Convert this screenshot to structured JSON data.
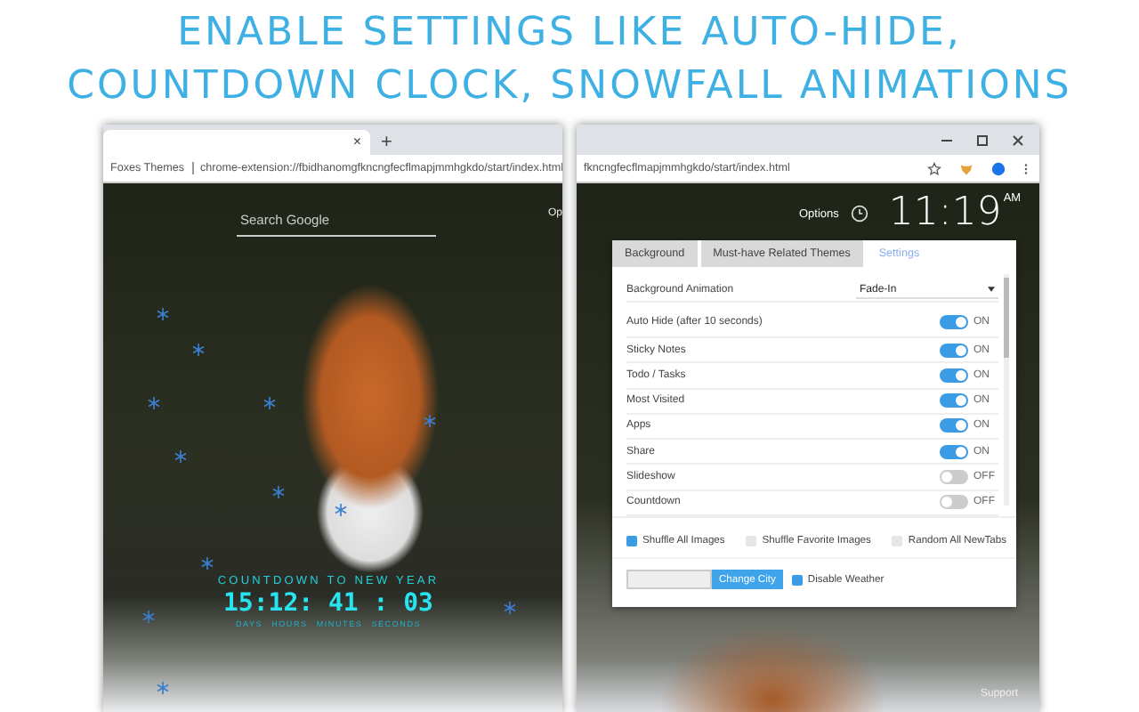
{
  "headline": [
    "ENABLE SETTINGS LIKE AUTO-HIDE,",
    "COUNTDOWN CLOCK, SNOWFALL ANIMATIONS"
  ],
  "left_window": {
    "tab_close": "×",
    "new_tab": "+",
    "site_name": "Foxes Themes",
    "url": "chrome-extension://fbidhanomgfkncngfecflmapjmmhgkdo/start/index.html",
    "search": {
      "placeholder": "Search Google"
    },
    "options_link": "Op",
    "countdown": {
      "title": "COUNTDOWN TO NEW YEAR",
      "time": "15:12: 41 : 03",
      "units": [
        "DAYS",
        "HOURS",
        "MINUTES",
        "SECONDS"
      ]
    }
  },
  "right_window": {
    "url": "fkncngfecflmapjmmhgkdo/start/index.html",
    "options_link": "Options",
    "clock": {
      "time": "11:19",
      "period": "AM"
    },
    "settings": {
      "tabs": [
        {
          "label": "Background",
          "selected": false
        },
        {
          "label": "Must-have Related Themes",
          "selected": false
        },
        {
          "label": "Settings",
          "selected": true
        }
      ],
      "animation": {
        "label": "Background Animation",
        "value": "Fade-In"
      },
      "toggles": [
        {
          "label": "Auto Hide (after 10 seconds)",
          "on": true,
          "state": "ON"
        },
        {
          "label": "Sticky Notes",
          "on": true,
          "state": "ON"
        },
        {
          "label": "Todo / Tasks",
          "on": true,
          "state": "ON"
        },
        {
          "label": "Most Visited",
          "on": true,
          "state": "ON"
        },
        {
          "label": "Apps",
          "on": true,
          "state": "ON"
        },
        {
          "label": "Share",
          "on": true,
          "state": "ON"
        },
        {
          "label": "Slideshow",
          "on": false,
          "state": "OFF"
        },
        {
          "label": "Countdown",
          "on": false,
          "state": "OFF"
        }
      ],
      "checkboxes": [
        {
          "label": "Shuffle All Images",
          "checked": true
        },
        {
          "label": "Shuffle Favorite Images",
          "checked": false
        },
        {
          "label": "Random All NewTabs",
          "checked": false
        }
      ],
      "city_button": "Change City",
      "weather": {
        "label": "Disable Weather",
        "checked": true
      }
    },
    "support_link": "Support"
  }
}
